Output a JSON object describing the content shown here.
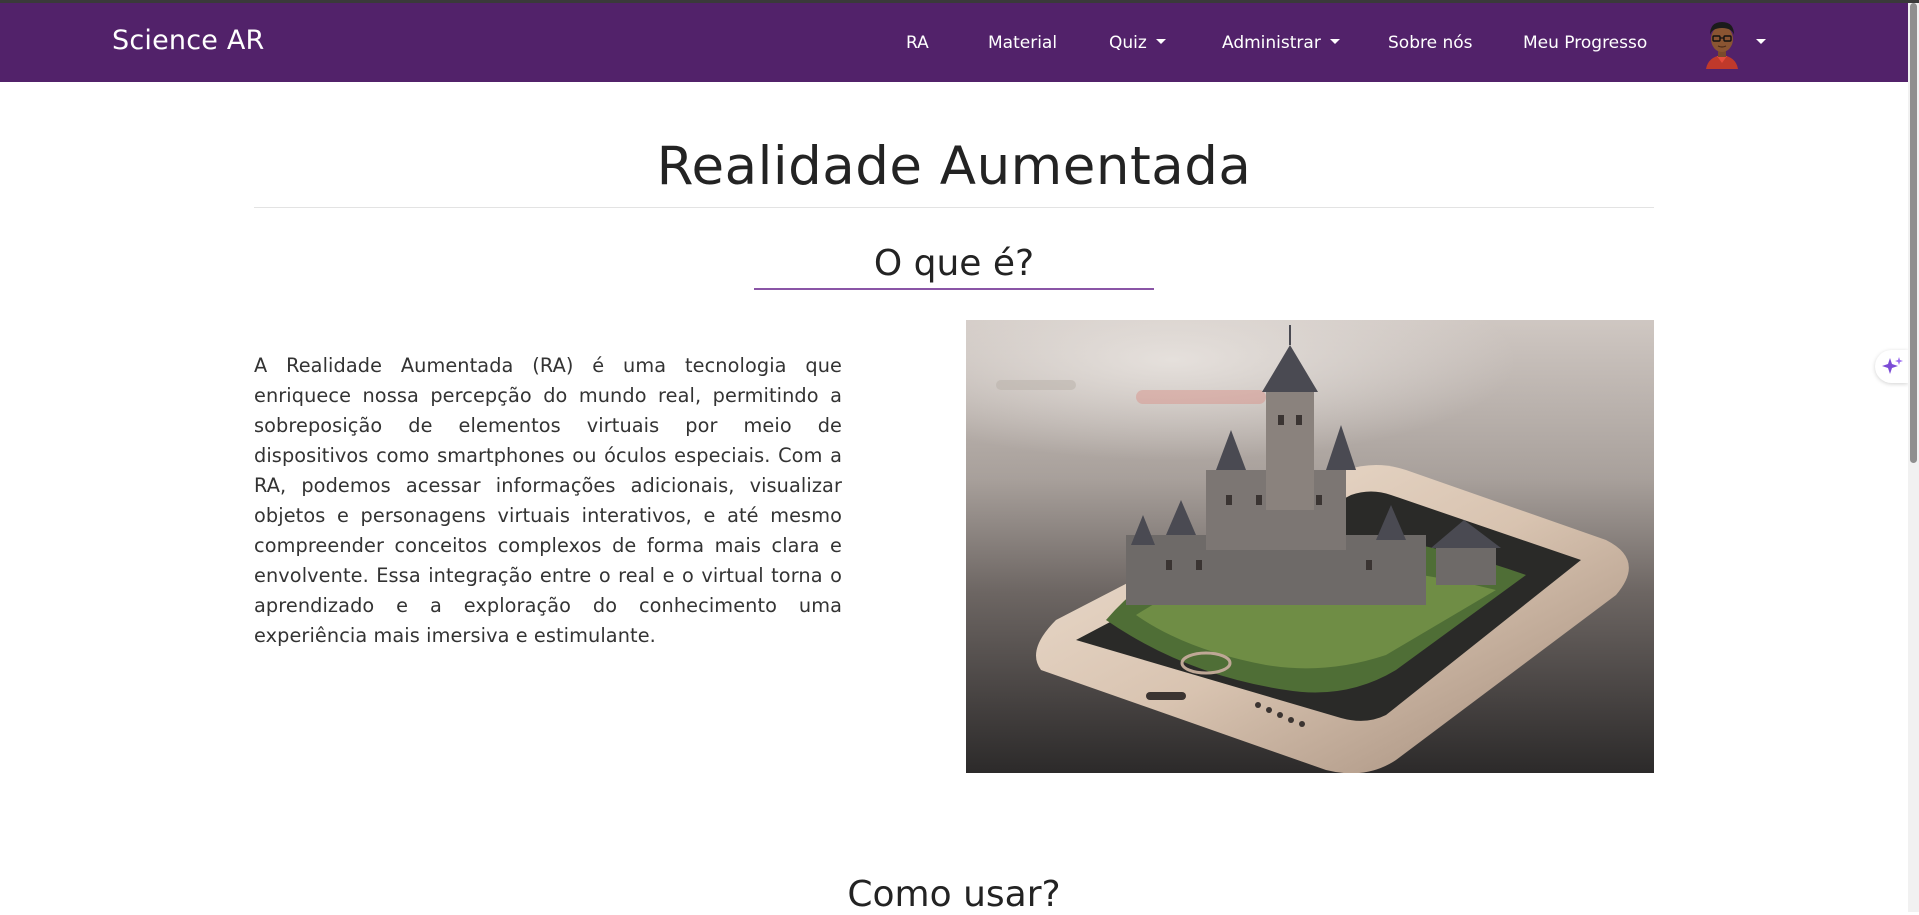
{
  "navbar": {
    "brand": "Science AR",
    "items": [
      {
        "label": "RA",
        "has_dropdown": false
      },
      {
        "label": "Material",
        "has_dropdown": false
      },
      {
        "label": "Quiz",
        "has_dropdown": true
      },
      {
        "label": "Administrar",
        "has_dropdown": true
      },
      {
        "label": "Sobre nós",
        "has_dropdown": false
      },
      {
        "label": "Meu Progresso",
        "has_dropdown": false
      }
    ],
    "avatar_icon": "user-avatar-icon",
    "background_color": "#52226a"
  },
  "main": {
    "title": "Realidade Aumentada",
    "section1": {
      "heading": "O que é?",
      "text": "A Realidade Aumentada (RA) é uma tecnologia que enriquece nossa percepção do mundo real, permitindo a sobreposição de elementos virtuais por meio de dispositivos como smartphones ou óculos especiais. Com a RA, podemos acessar informações adicionais, visualizar objetos e personagens virtuais interativos, e até mesmo compreender conceitos complexos de forma mais clara e envolvente. Essa integração entre o real e o virtual torna o aprendizado e a exploração do conhecimento uma experiência mais imersiva e estimulante.",
      "image_icon": "castle-on-smartphone-image"
    },
    "section2": {
      "heading": "Como usar?"
    },
    "accent_color": "#8a55a6"
  },
  "side_widget": {
    "icon": "sparkle-icon"
  }
}
